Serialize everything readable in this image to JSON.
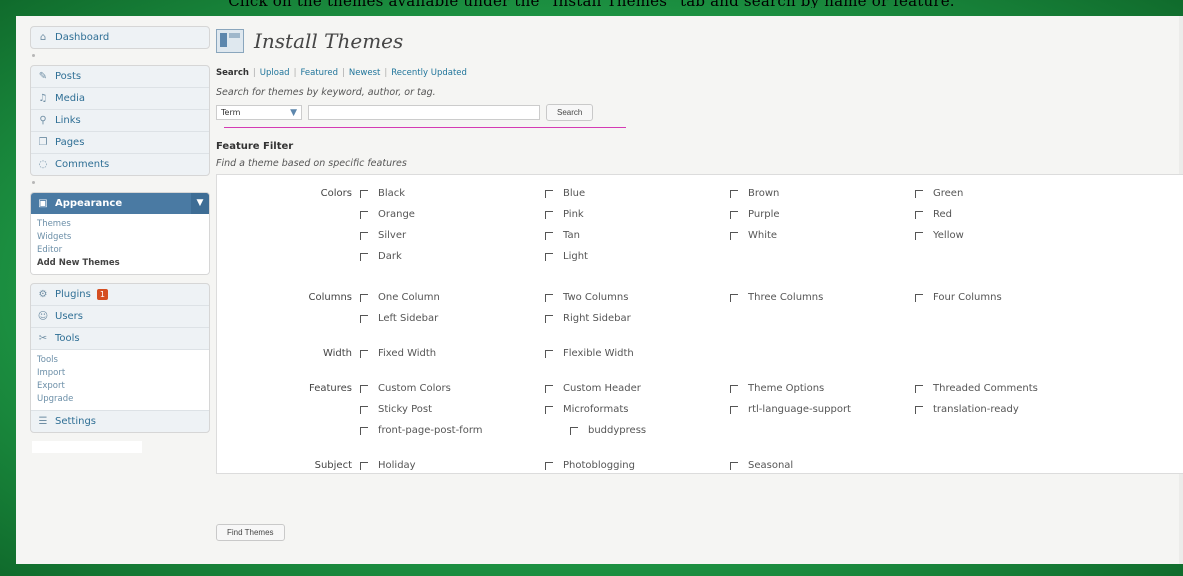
{
  "caption": "Click on the themes available under the “Install Themes” tab and search by name or feature.",
  "sidebar": {
    "top": [
      {
        "label": "Dashboard",
        "icon": "dashboard-icon"
      }
    ],
    "group1": [
      {
        "label": "Posts",
        "icon": "posts-icon"
      },
      {
        "label": "Media",
        "icon": "media-icon"
      },
      {
        "label": "Links",
        "icon": "links-icon"
      },
      {
        "label": "Pages",
        "icon": "pages-icon"
      },
      {
        "label": "Comments",
        "icon": "comments-icon"
      }
    ],
    "appearance": {
      "label": "Appearance",
      "sub": [
        "Themes",
        "Widgets",
        "Editor",
        "Add New Themes"
      ]
    },
    "group2": [
      {
        "label": "Plugins",
        "icon": "plugins-icon",
        "badge": "1"
      },
      {
        "label": "Users",
        "icon": "users-icon"
      },
      {
        "label": "Tools",
        "icon": "tools-icon"
      }
    ],
    "tools_sub": [
      "Tools",
      "Import",
      "Export",
      "Upgrade"
    ],
    "settings": {
      "label": "Settings",
      "icon": "settings-icon"
    }
  },
  "main": {
    "title": "Install Themes",
    "tabs": [
      "Search",
      "Upload",
      "Featured",
      "Newest",
      "Recently Updated"
    ],
    "search_hint": "Search for themes by keyword, author, or tag.",
    "term_select": "Term",
    "search_button": "Search",
    "feature_title": "Feature Filter",
    "feature_sub": "Find a theme based on specific features",
    "find_button": "Find Themes"
  },
  "filters": [
    {
      "label": "Colors",
      "options": [
        "Black",
        "Blue",
        "Brown",
        "Green",
        "Orange",
        "Pink",
        "Purple",
        "Red",
        "Silver",
        "Tan",
        "White",
        "Yellow",
        "Dark",
        "Light"
      ]
    },
    {
      "label": "Columns",
      "options": [
        "One Column",
        "Two Columns",
        "Three Columns",
        "Four Columns",
        "Left Sidebar",
        "Right Sidebar"
      ]
    },
    {
      "label": "Width",
      "options": [
        "Fixed Width",
        "Flexible Width"
      ]
    },
    {
      "label": "Features",
      "options": [
        "Custom Colors",
        "Custom Header",
        "Theme Options",
        "Threaded Comments",
        "Sticky Post",
        "Microformats",
        "rtl-language-support",
        "translation-ready",
        "front-page-post-form",
        "buddypress"
      ]
    },
    {
      "label": "Subject",
      "options": [
        "Holiday",
        "Photoblogging",
        "Seasonal"
      ]
    }
  ]
}
